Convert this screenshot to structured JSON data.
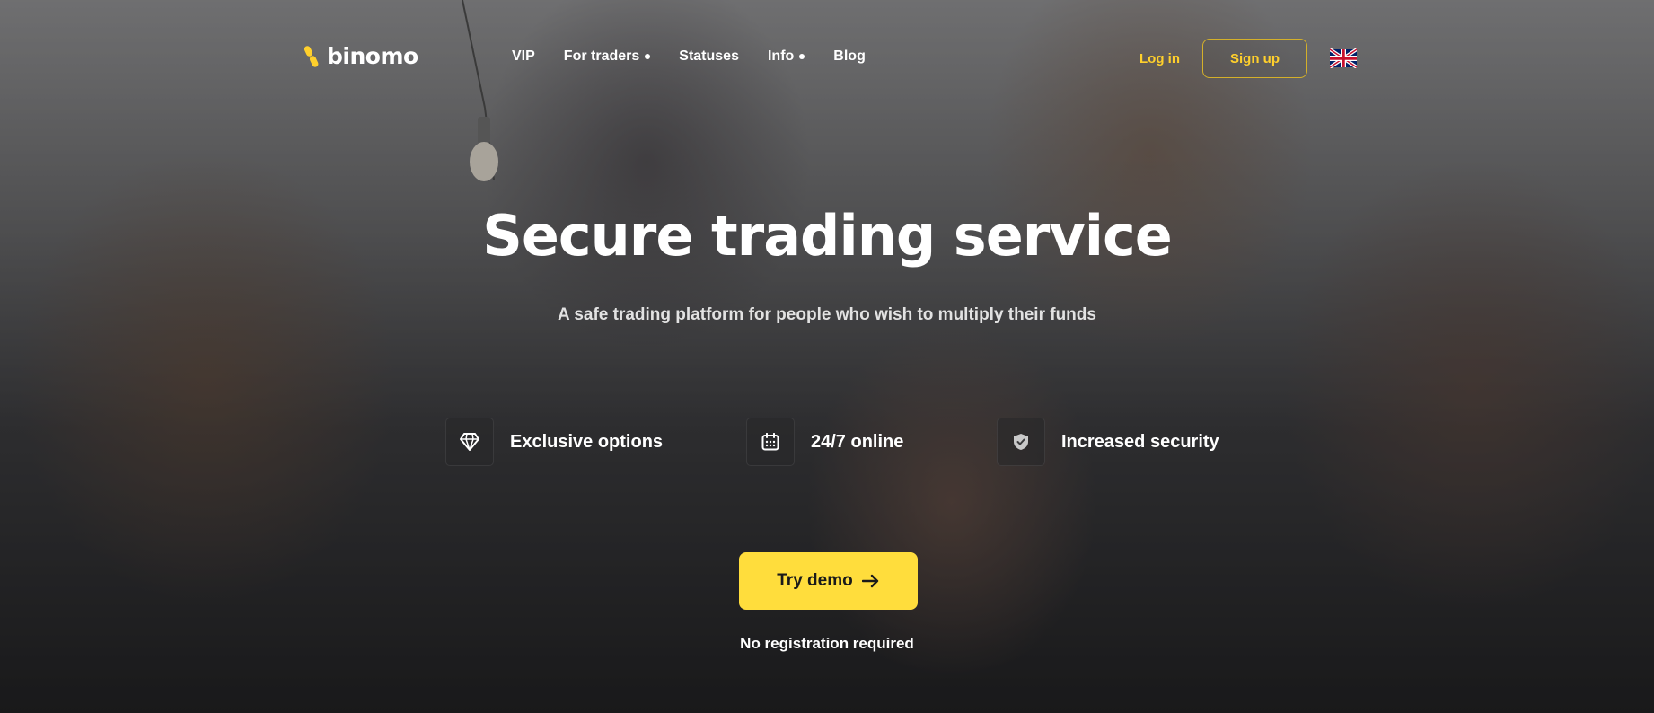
{
  "header": {
    "logo_text": "binomo",
    "nav": [
      {
        "label": "VIP",
        "has_dropdown": false
      },
      {
        "label": "For traders",
        "has_dropdown": true
      },
      {
        "label": "Statuses",
        "has_dropdown": false
      },
      {
        "label": "Info",
        "has_dropdown": true
      },
      {
        "label": "Blog",
        "has_dropdown": false
      }
    ],
    "login_label": "Log in",
    "signup_label": "Sign up",
    "language_icon": "uk-flag-icon"
  },
  "hero": {
    "title": "Secure trading service",
    "subtitle": "A safe trading platform for people who wish to multiply their funds"
  },
  "features": [
    {
      "icon": "diamond-icon",
      "label": "Exclusive options"
    },
    {
      "icon": "calendar-icon",
      "label": "24/7 online"
    },
    {
      "icon": "shield-check-icon",
      "label": "Increased security"
    }
  ],
  "cta": {
    "button_label": "Try demo",
    "button_icon": "arrow-right-icon",
    "note": "No registration required"
  },
  "colors": {
    "accent": "#ffdd3c",
    "login_text": "#ffd02c",
    "signup_border": "#d4b02a"
  }
}
